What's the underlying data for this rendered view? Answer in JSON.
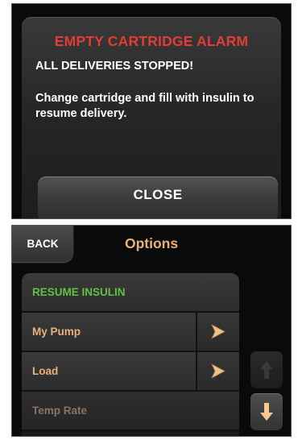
{
  "alarm": {
    "title": "EMPTY CARTRIDGE ALARM",
    "headline": "ALL DELIVERIES STOPPED!",
    "message": "Change cartridge and fill with insulin to resume delivery.",
    "close_label": "CLOSE",
    "title_color": "#e33b35"
  },
  "options": {
    "back_label": "BACK",
    "title": "Options",
    "items": [
      {
        "label": "RESUME INSULIN",
        "color": "#5fc145",
        "has_arrow": false,
        "enabled": true
      },
      {
        "label": "My Pump",
        "color": "#e8b07a",
        "has_arrow": true,
        "arrow_icon": "chevron-right-icon",
        "enabled": true
      },
      {
        "label": "Load",
        "color": "#e8b07a",
        "has_arrow": true,
        "arrow_icon": "chevron-right-icon",
        "enabled": true
      },
      {
        "label": "Temp Rate",
        "color": "#8a7462",
        "has_arrow": false,
        "enabled": false
      }
    ],
    "scroll_up_icon": "arrow-up-icon",
    "scroll_down_icon": "arrow-down-icon",
    "accent_color": "#e8b07a"
  }
}
